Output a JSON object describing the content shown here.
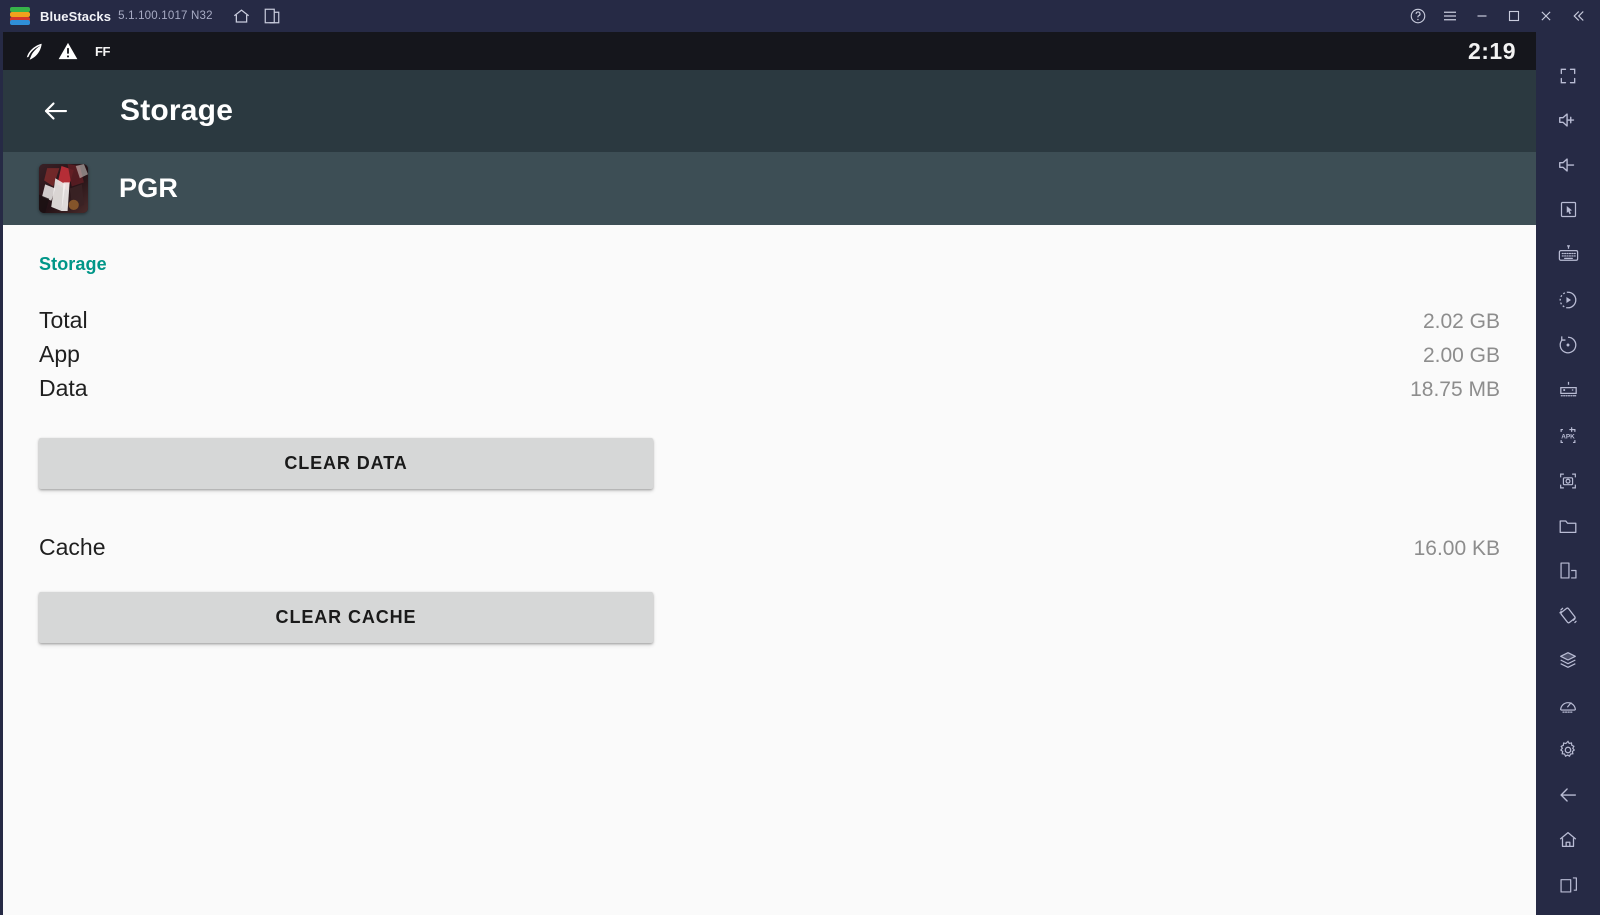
{
  "titlebar": {
    "app_name": "BlueStacks",
    "version": "5.1.100.1017 N32",
    "icons": {
      "logo": "bluestacks-logo-icon",
      "home": "home-icon",
      "multi_instance": "multi-instance-icon",
      "help": "help-icon",
      "menu": "menu-icon",
      "minimize": "minimize-icon",
      "maximize": "maximize-icon",
      "close": "close-icon",
      "collapse": "collapse-icon"
    }
  },
  "status_bar": {
    "quill_icon": "quill-icon",
    "warning_icon": "warning-icon",
    "ff_label": "FF",
    "clock": "2:19"
  },
  "header": {
    "back_label": "back-arrow",
    "title": "Storage"
  },
  "package": {
    "name": "PGR",
    "icon": "pgr-app-icon"
  },
  "storage": {
    "section_title": "Storage",
    "rows": [
      {
        "label": "Total",
        "value": "2.02 GB"
      },
      {
        "label": "App",
        "value": "2.00 GB"
      },
      {
        "label": "Data",
        "value": "18.75 MB"
      }
    ],
    "clear_data_label": "CLEAR DATA",
    "cache_label": "Cache",
    "cache_value": "16.00 KB",
    "clear_cache_label": "CLEAR CACHE"
  },
  "sidebar": {
    "items": [
      {
        "name": "fullscreen-icon",
        "label": "Fullscreen"
      },
      {
        "name": "volume-up-icon",
        "label": "Volume up"
      },
      {
        "name": "volume-down-icon",
        "label": "Volume down"
      },
      {
        "name": "cursor-pointer-icon",
        "label": "Click anywhere"
      },
      {
        "name": "keyboard-controls-icon",
        "label": "Game controls"
      },
      {
        "name": "macro-recorder-icon",
        "label": "Macro recorder"
      },
      {
        "name": "rotate-icon",
        "label": "Rotate"
      },
      {
        "name": "gamepad-icon",
        "label": "Gamepad"
      },
      {
        "name": "install-apk-icon",
        "label": "Install APK"
      },
      {
        "name": "screenshot-icon",
        "label": "Screenshot"
      },
      {
        "name": "media-manager-icon",
        "label": "Media manager"
      },
      {
        "name": "multi-instance-window-icon",
        "label": "Multi-instance"
      },
      {
        "name": "shake-icon",
        "label": "Shake"
      },
      {
        "name": "layers-icon",
        "label": "Multi-instance manager"
      },
      {
        "name": "eco-mode-icon",
        "label": "Eco mode"
      },
      {
        "name": "settings-gear-icon",
        "label": "Settings"
      },
      {
        "name": "back-nav-icon",
        "label": "Back"
      },
      {
        "name": "home-nav-icon",
        "label": "Home"
      },
      {
        "name": "recents-nav-icon",
        "label": "Recent apps"
      }
    ]
  },
  "colors": {
    "chrome": "#262a45",
    "status_bar": "#15161c",
    "header": "#2b3940",
    "package_bar": "#3d4e55",
    "content_bg": "#fafafa",
    "accent_teal": "#009688",
    "button_bg": "#d6d7d7",
    "value_text": "#8d8d8d"
  }
}
